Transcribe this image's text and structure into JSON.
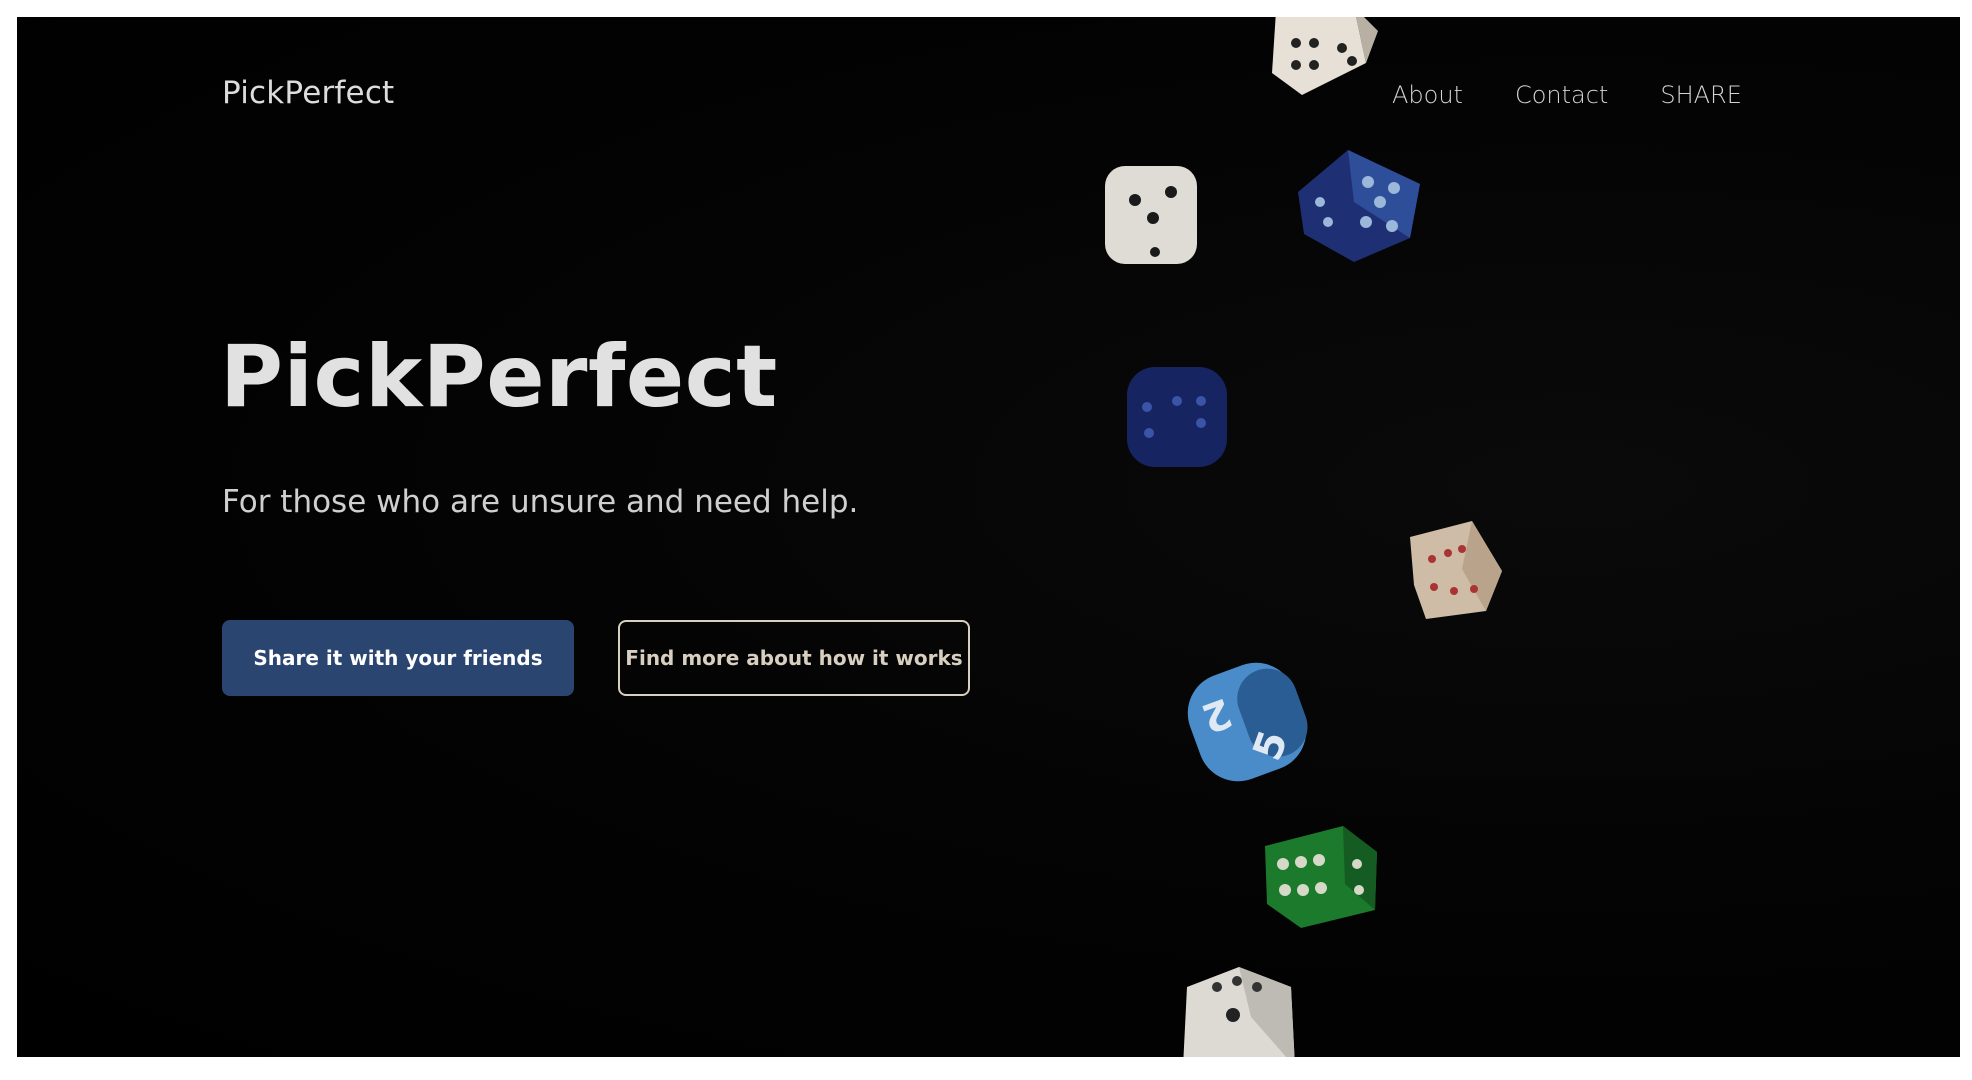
{
  "nav": {
    "brand": "PickPerfect",
    "links": [
      "About",
      "Contact",
      "SHARE"
    ]
  },
  "hero": {
    "title": "PickPerfect",
    "subtitle": "For those who are unsure and need help.",
    "primary_button": "Share it with your friends",
    "secondary_button": "Find more about how it works"
  },
  "decor": {
    "dice_colors": [
      "#e6e0d6",
      "#1f2f74",
      "#d6c2ab",
      "#4a8cc9",
      "#1c7a2c",
      "#dcdad3"
    ],
    "die_labels": [
      "2",
      "5"
    ]
  },
  "colors": {
    "background": "#000000",
    "primary_button": "#2a4570",
    "secondary_border": "#d8cfc0"
  }
}
